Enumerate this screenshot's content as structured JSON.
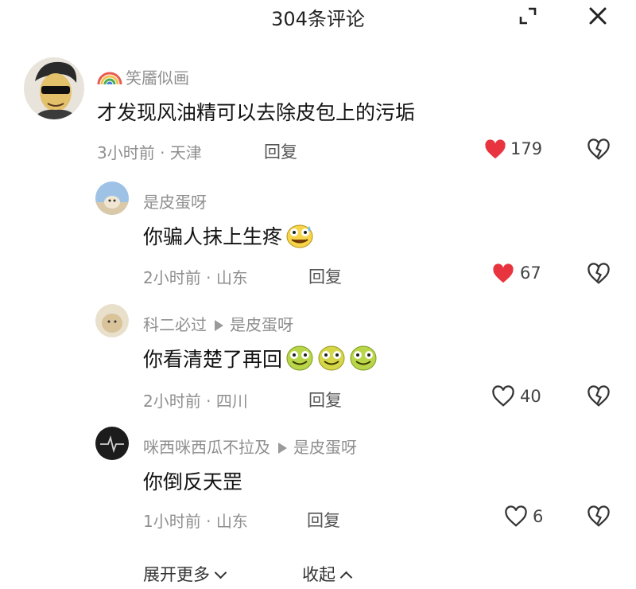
{
  "header": {
    "title": "304条评论",
    "expand_icon": "expand-icon",
    "close_icon": "close-icon"
  },
  "colors": {
    "liked_heart": "#e8343f",
    "secondary_text": "#8f8f8f"
  },
  "comment": {
    "author": "笑靥似画",
    "text": "才发现风油精可以去除皮包上的污垢",
    "time": "3小时前",
    "location": "天津",
    "reply_label": "回复",
    "likes": "179",
    "liked": true
  },
  "replies": [
    {
      "author": "是皮蛋呀",
      "reply_to": "",
      "text": "你骗人抹上生疼",
      "time": "2小时前",
      "location": "山东",
      "reply_label": "回复",
      "likes": "67",
      "liked": true,
      "emoji_count": 1
    },
    {
      "author": "科二必过",
      "reply_to": "是皮蛋呀",
      "text": "你看清楚了再回",
      "time": "2小时前",
      "location": "四川",
      "reply_label": "回复",
      "likes": "40",
      "liked": false,
      "emoji_count": 3
    },
    {
      "author": "咪西咪西瓜不拉及",
      "reply_to": "是皮蛋呀",
      "text": "你倒反天罡",
      "time": "1小时前",
      "location": "山东",
      "reply_label": "回复",
      "likes": "6",
      "liked": false,
      "emoji_count": 0
    }
  ],
  "footer": {
    "expand_label": "展开更多",
    "collapse_label": "收起"
  }
}
